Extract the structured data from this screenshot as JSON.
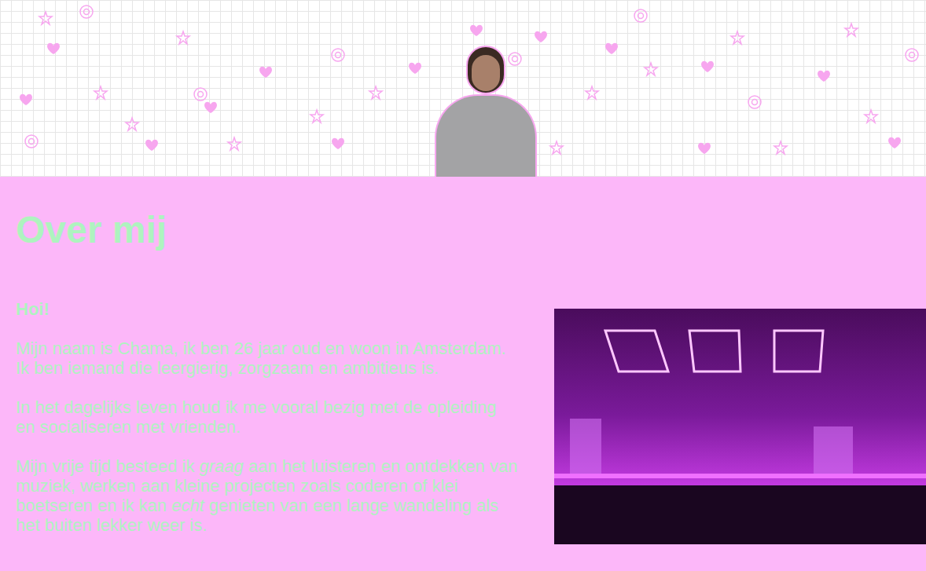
{
  "heading": "Over mij",
  "paragraphs": [
    {
      "lines": [
        [
          {
            "text": "Hoi!",
            "kind": "bold"
          }
        ]
      ]
    },
    {
      "lines": [
        [
          {
            "text": "Mijn naam is Chama, ik ben 26 jaar oud en woon in Amsterdam.",
            "kind": "normal"
          }
        ],
        [
          {
            "text": "Ik ben iemand die leergierig, zorgzaam en ambitieus is.",
            "kind": "normal"
          }
        ]
      ]
    },
    {
      "lines": [
        [
          {
            "text": "In het dagelijks leven houd ik me vooral bezig met de opleiding en socialiseren met vrienden.",
            "kind": "normal"
          }
        ]
      ]
    },
    {
      "lines": [
        [
          {
            "text": "Mijn vrije tijd besteed ik ",
            "kind": "normal"
          },
          {
            "text": "graag",
            "kind": "italic"
          },
          {
            "text": " aan het luisteren en ontdekken van muziek, werken aan kleine projecten zoals coderen of klei boetseren en ik kan ",
            "kind": "normal"
          },
          {
            "text": "echt",
            "kind": "italic"
          },
          {
            "text": " genieten van een lange wandeling als het buiten lekker weer is.",
            "kind": "normal"
          }
        ]
      ]
    }
  ]
}
